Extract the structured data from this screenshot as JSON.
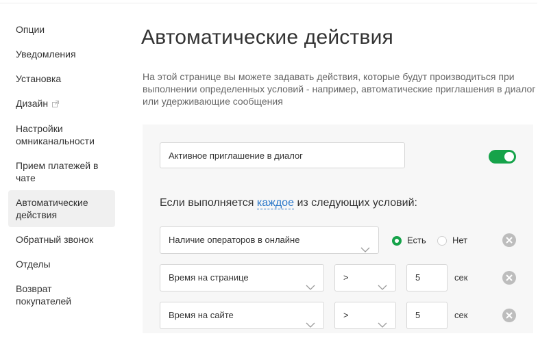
{
  "sidebar": {
    "items": [
      {
        "label": "Опции"
      },
      {
        "label": "Уведомления"
      },
      {
        "label": "Установка"
      },
      {
        "label": "Дизайн",
        "icon": "external-link-icon"
      },
      {
        "label": "Настройки омниканальности"
      },
      {
        "label": "Прием платежей в чате"
      },
      {
        "label": "Автоматические действия",
        "active": true
      },
      {
        "label": "Обратный звонок"
      },
      {
        "label": "Отделы"
      },
      {
        "label": "Возврат покупателей"
      }
    ]
  },
  "page": {
    "title": "Автоматические действия",
    "description": "На этой странице вы можете задавать действия, которые будут производиться при выполнении определенных условий - например, автоматические приглашения в диалог или удерживающие сообщения"
  },
  "rule": {
    "name": "Активное приглашение в диалог",
    "enabled": true,
    "conditions_prefix": "Если выполняется",
    "conditions_link": "каждое",
    "conditions_suffix": "из следующих условий:",
    "conditions": [
      {
        "field": "Наличие операторов в онлайне",
        "option_yes": "Есть",
        "option_no": "Нет",
        "selected": "Есть"
      },
      {
        "field": "Время на странице",
        "operator": ">",
        "value": "5",
        "unit": "сек"
      },
      {
        "field": "Время на сайте",
        "operator": ">",
        "value": "5",
        "unit": "сек"
      }
    ]
  },
  "colors": {
    "accent_green": "#16a34a",
    "link_blue": "#2a77c9",
    "panel_bg": "#f7f7f7"
  }
}
